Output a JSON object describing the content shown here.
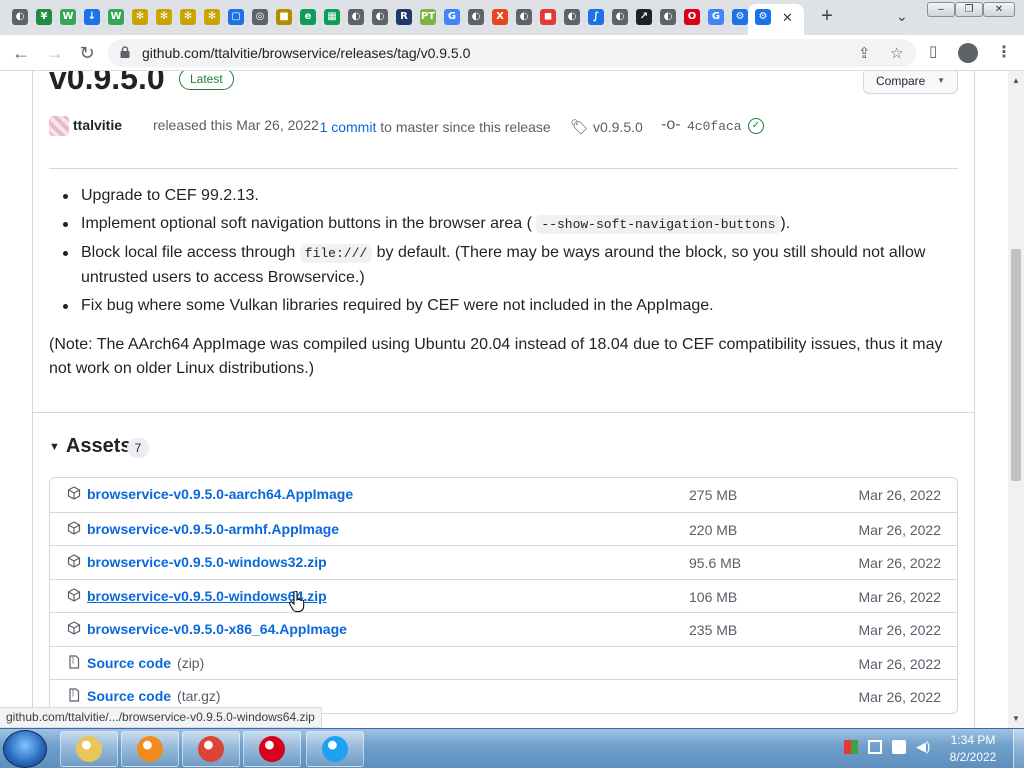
{
  "browser": {
    "tab_favicons": [
      {
        "icon": "circle-gray-icon",
        "color": "#5f6368",
        "glyph": "◐"
      },
      {
        "icon": "sheet-green-icon",
        "color": "#1e8e3e",
        "glyph": "¥"
      },
      {
        "icon": "wp-green-icon",
        "color": "#34a853",
        "glyph": "W"
      },
      {
        "icon": "download-blue-icon",
        "color": "#1a73e8",
        "glyph": "↓"
      },
      {
        "icon": "wp-green-icon",
        "color": "#34a853",
        "glyph": "W"
      },
      {
        "icon": "bee-icon",
        "color": "#c9a400",
        "glyph": "✻"
      },
      {
        "icon": "bee-icon",
        "color": "#c9a400",
        "glyph": "✻"
      },
      {
        "icon": "bee-icon",
        "color": "#c9a400",
        "glyph": "✻"
      },
      {
        "icon": "bee-icon",
        "color": "#c9a400",
        "glyph": "✻"
      },
      {
        "icon": "square-blue-icon",
        "color": "#1a73e8",
        "glyph": "▢"
      },
      {
        "icon": "chrome-icon",
        "color": "#5f6368",
        "glyph": "◎"
      },
      {
        "icon": "square-yellow-icon",
        "color": "#b58b00",
        "glyph": "■"
      },
      {
        "icon": "e-green-icon",
        "color": "#0f9d58",
        "glyph": "e"
      },
      {
        "icon": "sheet-green-icon",
        "color": "#0f9d58",
        "glyph": "▦"
      },
      {
        "icon": "circle-gray-icon",
        "color": "#5f6368",
        "glyph": "◐"
      },
      {
        "icon": "circle-gray-icon",
        "color": "#5f6368",
        "glyph": "◐"
      },
      {
        "icon": "r-icon",
        "color": "#1f3a68",
        "glyph": "R"
      },
      {
        "icon": "pt-icon",
        "color": "#7cb342",
        "glyph": "PT"
      },
      {
        "icon": "google-icon",
        "color": "#4285f4",
        "glyph": "G"
      },
      {
        "icon": "circle-gray-icon",
        "color": "#5f6368",
        "glyph": "◐"
      },
      {
        "icon": "x-red-icon",
        "color": "#e8451d",
        "glyph": "X"
      },
      {
        "icon": "circle-gray-icon",
        "color": "#5f6368",
        "glyph": "◐"
      },
      {
        "icon": "colorful-icon",
        "color": "#e53935",
        "glyph": "◼"
      },
      {
        "icon": "circle-gray-icon",
        "color": "#5f6368",
        "glyph": "◐"
      },
      {
        "icon": "wave-blue-icon",
        "color": "#1a73e8",
        "glyph": "∫"
      },
      {
        "icon": "circle-gray-icon",
        "color": "#5f6368",
        "glyph": "◐"
      },
      {
        "icon": "chart-dark-icon",
        "color": "#202124",
        "glyph": "↗"
      },
      {
        "icon": "circle-gray-icon",
        "color": "#5f6368",
        "glyph": "◐"
      },
      {
        "icon": "opera-icon",
        "color": "#d9001b",
        "glyph": "O"
      },
      {
        "icon": "google-icon",
        "color": "#4285f4",
        "glyph": "G"
      },
      {
        "icon": "gear-blue-icon",
        "color": "#1a73e8",
        "glyph": "⚙"
      }
    ],
    "close_tab": "✕",
    "new_tab": "+",
    "tab_search": "⌄",
    "url": "github.com/ttalvitie/browservice/releases/tag/v0.9.5.0",
    "status_url": "github.com/ttalvitie/.../browservice-v0.9.5.0-windows64.zip"
  },
  "release": {
    "title": "v0.9.5.0",
    "latest_badge": "Latest",
    "compare_label": "Compare",
    "author": "ttalvitie",
    "released_text": "released this Mar 26, 2022",
    "commits_prefix": "·",
    "commits_link": "1 commit",
    "commits_suffix": "to master since this release",
    "tag": "v0.9.5.0",
    "commit_sha": "4c0faca",
    "notes": {
      "item1": "Upgrade to CEF 99.2.13.",
      "item2_pre": "Implement optional soft navigation buttons in the browser area (",
      "item2_code": "--show-soft-navigation-buttons",
      "item2_post": ").",
      "item3_pre": "Block local file access through",
      "item3_code": "file:///",
      "item3_post": "by default. (There may be ways around the block, so you still should not allow untrusted users to access Browservice.)",
      "item4": "Fix bug where some Vulkan libraries required by CEF were not included in the AppImage.",
      "note": "(Note: The AArch64 AppImage was compiled using Ubuntu 20.04 instead of 18.04 due to CEF compatibility issues, thus it may not work on older Linux distributions.)"
    }
  },
  "assets": {
    "heading": "Assets",
    "count": "7",
    "rows": [
      {
        "name": "browservice-v0.9.5.0-aarch64.AppImage",
        "sub": "",
        "size": "275 MB",
        "date": "Mar 26, 2022",
        "icon": "package-icon"
      },
      {
        "name": "browservice-v0.9.5.0-armhf.AppImage",
        "sub": "",
        "size": "220 MB",
        "date": "Mar 26, 2022",
        "icon": "package-icon"
      },
      {
        "name": "browservice-v0.9.5.0-windows32.zip",
        "sub": "",
        "size": "95.6 MB",
        "date": "Mar 26, 2022",
        "icon": "package-icon"
      },
      {
        "name": "browservice-v0.9.5.0-windows64.zip",
        "sub": "",
        "size": "106 MB",
        "date": "Mar 26, 2022",
        "icon": "package-icon"
      },
      {
        "name": "browservice-v0.9.5.0-x86_64.AppImage",
        "sub": "",
        "size": "235 MB",
        "date": "Mar 26, 2022",
        "icon": "package-icon"
      },
      {
        "name": "Source code",
        "sub": "(zip)",
        "size": "",
        "date": "Mar 26, 2022",
        "icon": "file-zip-icon"
      },
      {
        "name": "Source code",
        "sub": "(tar.gz)",
        "size": "",
        "date": "Mar 26, 2022",
        "icon": "file-zip-icon"
      }
    ]
  },
  "taskbar": {
    "apps": [
      {
        "name": "file-explorer",
        "color": "#e8c65a"
      },
      {
        "name": "media-player",
        "color": "#f28b1e"
      },
      {
        "name": "chrome",
        "color": "#db4437"
      },
      {
        "name": "opera",
        "color": "#d9001b"
      },
      {
        "name": "internet-explorer",
        "color": "#1ea1f2"
      }
    ],
    "time": "1:34 PM",
    "date": "8/2/2022"
  }
}
